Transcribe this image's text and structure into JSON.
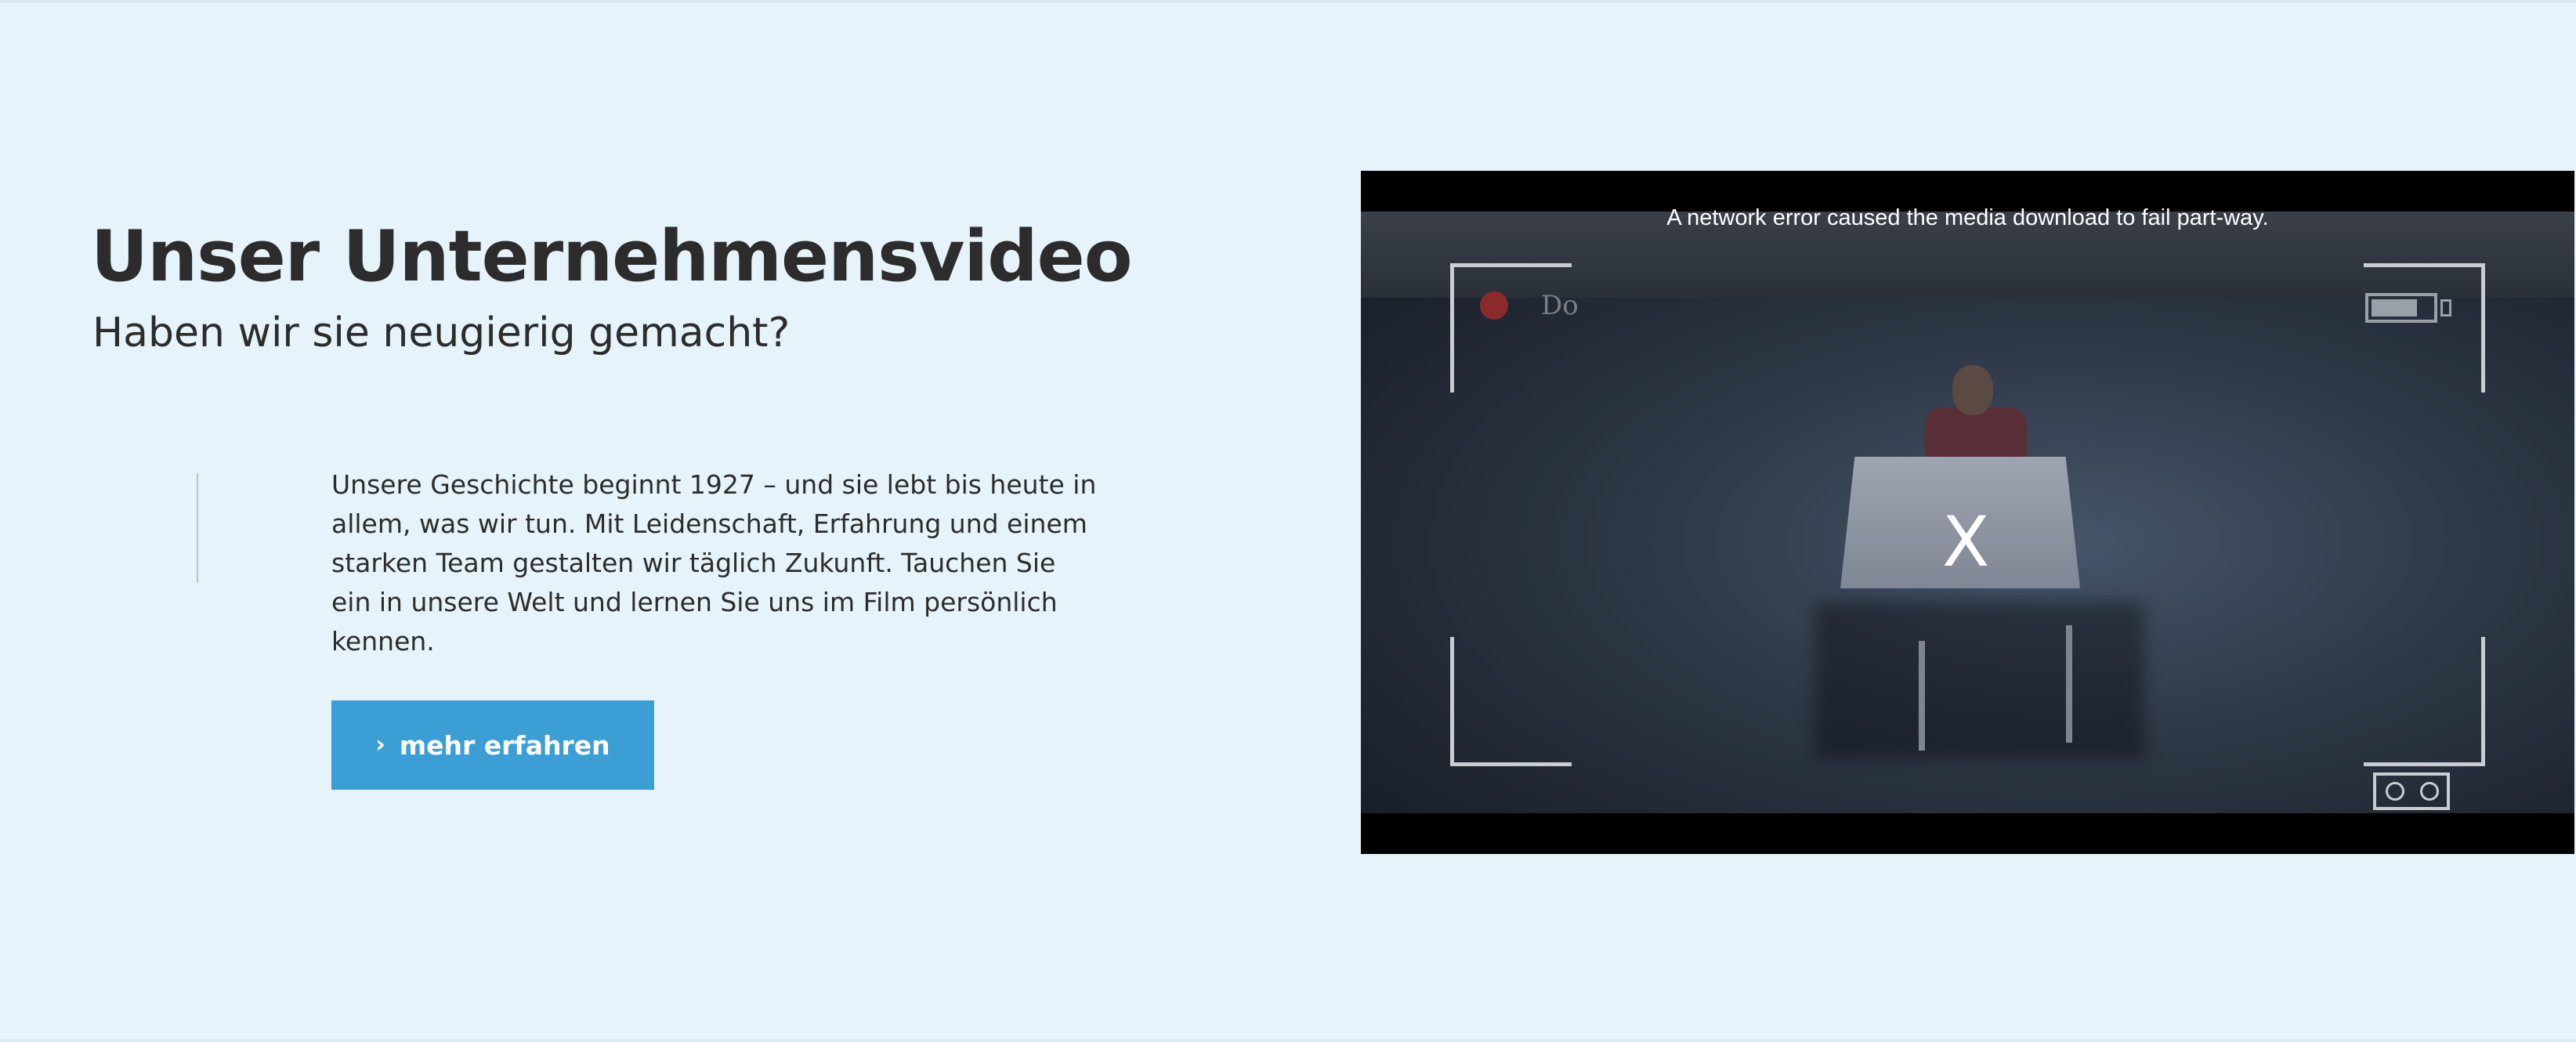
{
  "header": {
    "title": "Unser Unternehmensvideo",
    "subtitle": "Haben wir sie neugierig gemacht?"
  },
  "content": {
    "paragraph": "Unsere Geschichte beginnt 1927 – und sie lebt bis heute in allem, was wir tun. Mit Leidenschaft, Erfahrung und einem starken Team gestalten wir täglich Zukunft. Tauchen Sie ein in unsere Welt und lernen Sie uns im Film persönlich kennen.",
    "cta_label": "mehr erfahren",
    "cta_icon": "chevron-right-icon"
  },
  "video": {
    "error_message": "A network error caused the media download to fail part-way.",
    "error_symbol": "X",
    "overlay_rec_text": "Do"
  },
  "colors": {
    "background": "#e6f3fa",
    "text": "#2c2c2c",
    "accent": "#3b9fd6"
  }
}
